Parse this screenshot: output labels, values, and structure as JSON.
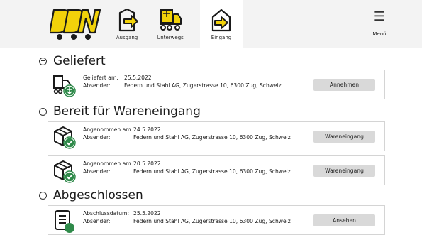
{
  "nav": {
    "items": [
      {
        "label": "Ausgang",
        "icon": "export-arrow-icon"
      },
      {
        "label": "Unterwegs",
        "icon": "truck-icon"
      },
      {
        "label": "Eingang",
        "icon": "import-arrow-icon"
      }
    ],
    "menu_label": "Menü",
    "colors": {
      "accent": "#f2d20a"
    }
  },
  "sections": {
    "delivered": {
      "title": "Geliefert",
      "cards": [
        {
          "date_label": "Geliefert am:",
          "date": "25.5.2022",
          "sender_label": "Absender:",
          "sender": "Federn und Stahl AG, Zugerstrasse 10, 6300 Zug, Schweiz",
          "button": "Annehmen"
        }
      ]
    },
    "ready": {
      "title": "Bereit für Wareneingang",
      "cards": [
        {
          "date_label": "Angenommen am:",
          "date": "24.5.2022",
          "sender_label": "Absender:",
          "sender": "Federn und Stahl AG, Zugerstrasse 10, 6300 Zug, Schweiz",
          "button": "Wareneingang"
        },
        {
          "date_label": "Angenommen am:",
          "date": "20.5.2022",
          "sender_label": "Absender:",
          "sender": "Federn und Stahl AG, Zugerstrasse 10, 6300 Zug, Schweiz",
          "button": "Wareneingang"
        }
      ]
    },
    "closed": {
      "title": "Abgeschlossen",
      "cards": [
        {
          "date_label": "Abschlussdatum:",
          "date": "25.5.2022",
          "sender_label": "Absender:",
          "sender": "Federn und Stahl AG, Zugerstrasse 10, 6300 Zug, Schweiz",
          "button": "Ansehen"
        }
      ]
    }
  }
}
